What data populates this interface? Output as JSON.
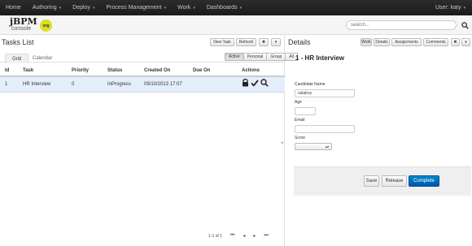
{
  "topnav": {
    "items": [
      {
        "label": "Home"
      },
      {
        "label": "Authoring",
        "caret": "▾"
      },
      {
        "label": "Deploy",
        "caret": "▾"
      },
      {
        "label": "Process Management",
        "caret": "▾"
      },
      {
        "label": "Work",
        "caret": "▾"
      },
      {
        "label": "Dashboards",
        "caret": "▾"
      }
    ],
    "user": "User: katy",
    "user_caret": "▾"
  },
  "brand": {
    "logo": "jBPM",
    "console": "console",
    "badge": "org"
  },
  "search": {
    "placeholder": "search..."
  },
  "tasks": {
    "title": "Tasks List",
    "toolbar": {
      "new_task": "New Task",
      "refresh": "Refresh",
      "close": "✖",
      "menu": "▾"
    },
    "tabs": {
      "grid": "Grid",
      "calendar": "Calendar"
    },
    "filters": [
      "Active",
      "Personal",
      "Group",
      "All"
    ],
    "columns": [
      "Id",
      "Task",
      "Priority",
      "Status",
      "Created On",
      "Due On",
      "Actions"
    ],
    "rows": [
      {
        "id": "1",
        "task": "HR Interview",
        "priority": "0",
        "status": "InProgress",
        "created": "09/10/2013 17:07",
        "due": ""
      }
    ],
    "pager": {
      "range": "1-1 of 1",
      "first": "⏮",
      "prev": "◂",
      "next": "▸",
      "last": "⏭"
    }
  },
  "details": {
    "title": "Details",
    "tabs": [
      "Work",
      "Details",
      "Assignments",
      "Comments"
    ],
    "close": "✖",
    "menu": "▾",
    "task_title": "1 - HR Interview",
    "form": {
      "candidate_label": "Candidate Name",
      "candidate_value": "salaboy",
      "age_label": "Age",
      "age_value": "",
      "email_label": "Email",
      "email_value": "",
      "score_label": "Score",
      "score_value": ""
    },
    "buttons": {
      "save": "Save",
      "release": "Release",
      "complete": "Complete"
    }
  },
  "colors": {
    "accent": "#0066cc",
    "selected_row": "#e4eefb",
    "logo_badge": "#d9e021"
  }
}
